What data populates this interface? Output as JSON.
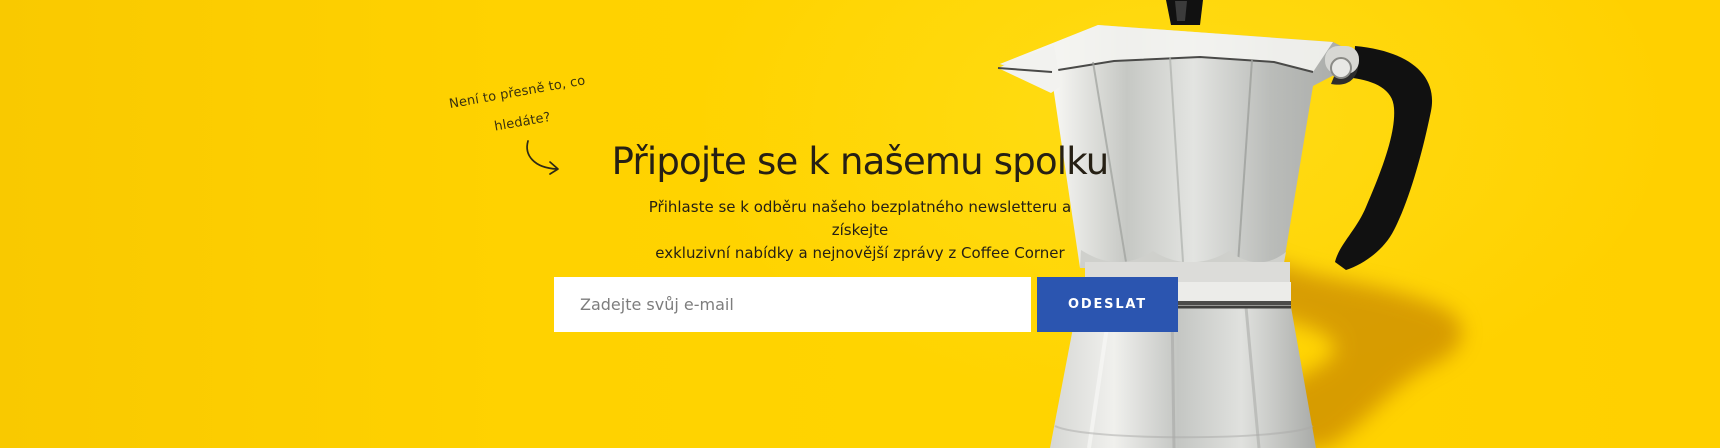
{
  "note": {
    "line1": "Není to přesně to, co",
    "line2": "hledáte?"
  },
  "newsletter": {
    "title": "Připojte se k našemu spolku",
    "description_line1": "Přihlaste se k odběru našeho bezplatného newsletteru a získejte",
    "description_line2": "exkluzivní nabídky a nejnovější zprávy z Coffee Corner"
  },
  "form": {
    "email_placeholder": "Zadejte svůj e-mail",
    "email_value": "",
    "submit_label": "ODESLAT"
  },
  "colors": {
    "background": "#ffd000",
    "button": "#2b55b0",
    "text": "#262014"
  },
  "icons": {
    "note_arrow": "curved-arrow-icon",
    "product": "moka-pot-image"
  }
}
